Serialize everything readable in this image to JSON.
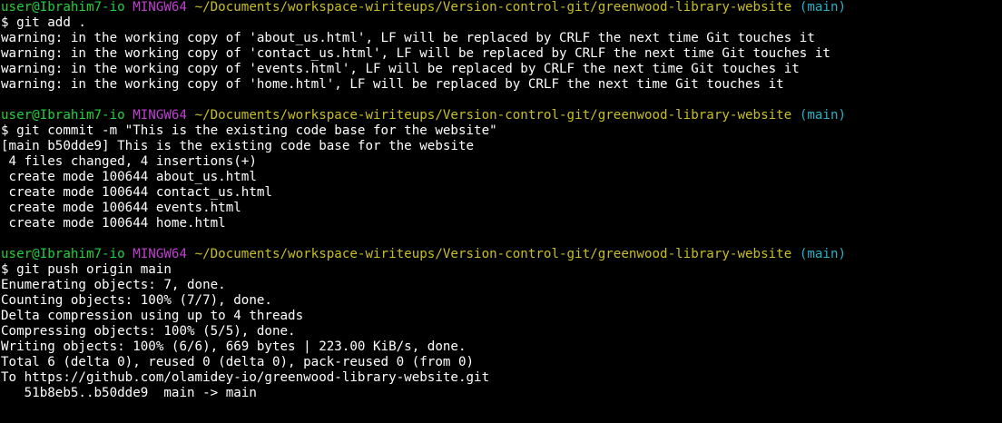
{
  "terminal": {
    "colors": {
      "background": "#000000",
      "text": "#ffffff",
      "user_host": "#23d13a",
      "mingw": "#c13fd1",
      "path": "#c9bf24",
      "branch": "#27b3c7"
    },
    "blocks": [
      {
        "prompt": {
          "user_host": "user@Ibrahim7-io",
          "env": "MINGW64",
          "path": "~/Documents/workspace-wiriteups/Version-control-git/greenwood-library-website",
          "branch": "(main)"
        },
        "command": "$ git add .",
        "output": [
          "warning: in the working copy of 'about_us.html', LF will be replaced by CRLF the next time Git touches it",
          "warning: in the working copy of 'contact_us.html', LF will be replaced by CRLF the next time Git touches it",
          "warning: in the working copy of 'events.html', LF will be replaced by CRLF the next time Git touches it",
          "warning: in the working copy of 'home.html', LF will be replaced by CRLF the next time Git touches it"
        ]
      },
      {
        "prompt": {
          "user_host": "user@Ibrahim7-io",
          "env": "MINGW64",
          "path": "~/Documents/workspace-wiriteups/Version-control-git/greenwood-library-website",
          "branch": "(main)"
        },
        "command": "$ git commit -m \"This is the existing code base for the website\"",
        "output": [
          "[main b50dde9] This is the existing code base for the website",
          " 4 files changed, 4 insertions(+)",
          " create mode 100644 about_us.html",
          " create mode 100644 contact_us.html",
          " create mode 100644 events.html",
          " create mode 100644 home.html"
        ]
      },
      {
        "prompt": {
          "user_host": "user@Ibrahim7-io",
          "env": "MINGW64",
          "path": "~/Documents/workspace-wiriteups/Version-control-git/greenwood-library-website",
          "branch": "(main)"
        },
        "command": "$ git push origin main",
        "output": [
          "Enumerating objects: 7, done.",
          "Counting objects: 100% (7/7), done.",
          "Delta compression using up to 4 threads",
          "Compressing objects: 100% (5/5), done.",
          "Writing objects: 100% (6/6), 669 bytes | 223.00 KiB/s, done.",
          "Total 6 (delta 0), reused 0 (delta 0), pack-reused 0 (from 0)",
          "To https://github.com/olamidey-io/greenwood-library-website.git",
          "   51b8eb5..b50dde9  main -> main"
        ]
      }
    ]
  }
}
